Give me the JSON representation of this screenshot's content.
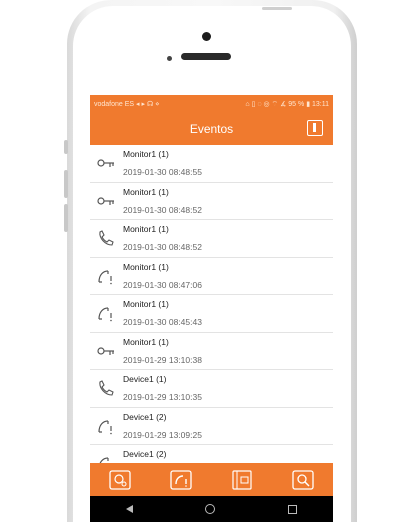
{
  "status_bar": {
    "left": "vodafone ES ◂ ▸ ☊ ⋄",
    "right": "⌂ ▯ ◌ ◎ ⌔  ∡ 95 % ▮ 13:11"
  },
  "header": {
    "title": "Eventos"
  },
  "events": [
    {
      "icon": "key",
      "name": "Monitor1 (1)",
      "time": "2019-01-30 08:48:55"
    },
    {
      "icon": "key",
      "name": "Monitor1 (1)",
      "time": "2019-01-30 08:48:52"
    },
    {
      "icon": "call",
      "name": "Monitor1 (1)",
      "time": "2019-01-30 08:48:52"
    },
    {
      "icon": "missed-call",
      "name": "Monitor1 (1)",
      "time": "2019-01-30 08:47:06"
    },
    {
      "icon": "missed-call",
      "name": "Monitor1 (1)",
      "time": "2019-01-30 08:45:43"
    },
    {
      "icon": "key",
      "name": "Monitor1 (1)",
      "time": "2019-01-29 13:10:38"
    },
    {
      "icon": "call",
      "name": "Device1 (1)",
      "time": "2019-01-29 13:10:35"
    },
    {
      "icon": "missed-call",
      "name": "Device1 (2)",
      "time": "2019-01-29 13:09:25"
    },
    {
      "icon": "missed-call",
      "name": "Device1 (2)",
      "time": ""
    }
  ],
  "bottom_nav": [
    {
      "icon": "monitor-user-icon"
    },
    {
      "icon": "call-alert-icon"
    },
    {
      "icon": "media-gallery-icon"
    },
    {
      "icon": "settings-search-icon"
    }
  ],
  "colors": {
    "accent": "#f07a2e",
    "nav": "#000000"
  }
}
